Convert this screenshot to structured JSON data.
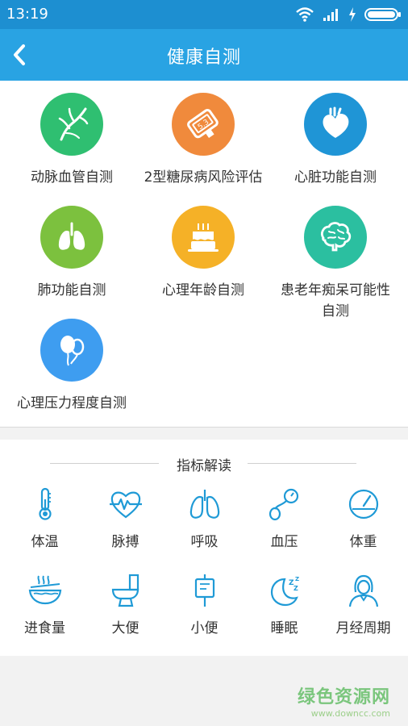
{
  "status_bar": {
    "time": "13:19"
  },
  "app_bar": {
    "title": "健康自测"
  },
  "self_tests": [
    {
      "label": "动脉血管自测",
      "icon": "artery-icon",
      "color": "#2fbf71"
    },
    {
      "label": "2型糖尿病风险评估",
      "icon": "glucose-meter-icon",
      "color": "#f08a3c"
    },
    {
      "label": "心脏功能自测",
      "icon": "heart-icon",
      "color": "#1f95d6"
    },
    {
      "label": "肺功能自测",
      "icon": "lungs-icon",
      "color": "#7cc13e"
    },
    {
      "label": "心理年龄自测",
      "icon": "birthday-cake-icon",
      "color": "#f5b127"
    },
    {
      "label": "患老年痴呆可能性自测",
      "icon": "brain-icon",
      "color": "#2bbfa0"
    },
    {
      "label": "心理压力程度自测",
      "icon": "balloons-icon",
      "color": "#3e9df0"
    }
  ],
  "indicators": {
    "heading": "指标解读",
    "items": [
      {
        "label": "体温",
        "icon": "thermometer-icon"
      },
      {
        "label": "脉搏",
        "icon": "pulse-heart-icon"
      },
      {
        "label": "呼吸",
        "icon": "lungs-outline-icon"
      },
      {
        "label": "血压",
        "icon": "blood-pressure-icon"
      },
      {
        "label": "体重",
        "icon": "scale-icon"
      },
      {
        "label": "进食量",
        "icon": "noodle-bowl-icon"
      },
      {
        "label": "大便",
        "icon": "toilet-icon"
      },
      {
        "label": "小便",
        "icon": "urine-bag-icon"
      },
      {
        "label": "睡眠",
        "icon": "moon-sleep-icon"
      },
      {
        "label": "月经周期",
        "icon": "woman-icon"
      }
    ],
    "accent_color": "#1f9ad6"
  },
  "watermark": {
    "name": "绿色资源网",
    "url": "www.downcc.com"
  }
}
